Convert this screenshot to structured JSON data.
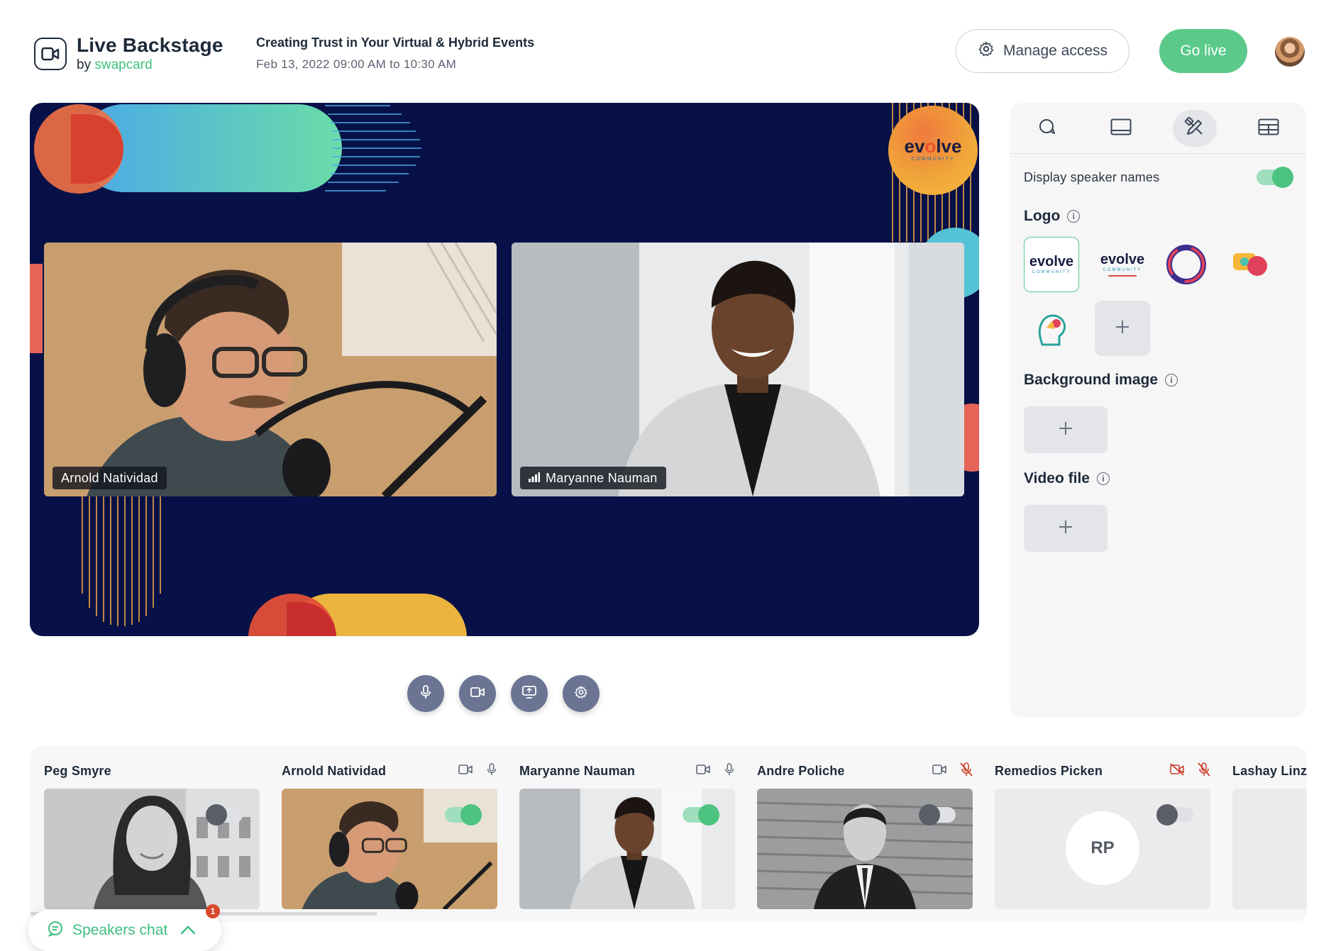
{
  "header": {
    "brand_title": "Live Backstage",
    "brand_by": "by ",
    "brand_company": "swapcard",
    "event_title": "Creating Trust in Your Virtual & Hybrid Events",
    "event_date": "Feb 13, 2022 09:00 AM to 10:30 AM",
    "manage_access_label": "Manage access",
    "go_live_label": "Go live"
  },
  "stage": {
    "logo_text_a": "ev",
    "logo_text_o": "o",
    "logo_text_b": "lve",
    "logo_sub": "COMMUNITY",
    "speakers": [
      {
        "name": "Arnold Natividad"
      },
      {
        "name": "Maryanne Nauman"
      }
    ]
  },
  "controls": [
    "microphone-icon",
    "camera-icon",
    "screen-share-icon",
    "settings-icon"
  ],
  "panel": {
    "tabs": [
      "chat-icon",
      "display-icon",
      "design-icon",
      "layout-icon"
    ],
    "display_speaker_names_label": "Display speaker names",
    "display_speaker_names_on": true,
    "logo_title": "Logo",
    "background_title": "Background image",
    "video_title": "Video file",
    "logos": [
      {
        "text": "evolve",
        "sub": "COMMUNITY"
      },
      {
        "text": "evolve",
        "sub": "COMMUNITY"
      }
    ]
  },
  "speakers_strip": [
    {
      "name": "Peg Smyre",
      "show_icons": false,
      "toggle_on": false
    },
    {
      "name": "Arnold Natividad",
      "show_icons": true,
      "cam_off": false,
      "mic_off": false,
      "toggle_on": true
    },
    {
      "name": "Maryanne Nauman",
      "show_icons": true,
      "cam_off": false,
      "mic_off": false,
      "toggle_on": true
    },
    {
      "name": "Andre Poliche",
      "show_icons": true,
      "cam_off": false,
      "mic_off": true,
      "toggle_on": false
    },
    {
      "name": "Remedios Picken",
      "show_icons": true,
      "cam_off": true,
      "mic_off": true,
      "toggle_on": false,
      "initials": "RP"
    },
    {
      "name": "Lashay Linz"
    }
  ],
  "chat": {
    "label": "Speakers chat",
    "badge": "1"
  },
  "colors": {
    "accent": "#5ac98a",
    "stage_bg": "#071147",
    "control": "#6b7593",
    "muted_red": "#c8412b"
  }
}
